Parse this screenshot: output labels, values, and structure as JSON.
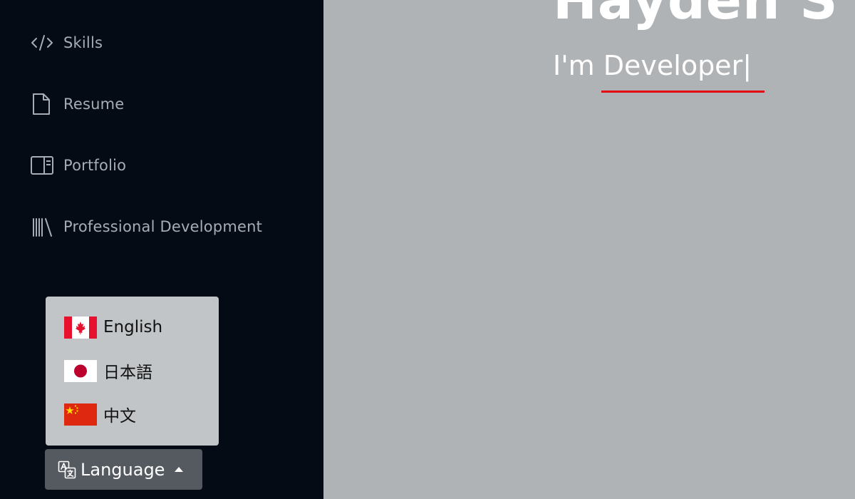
{
  "sidebar": {
    "items": [
      {
        "label": "Skills",
        "icon": "code-icon"
      },
      {
        "label": "Resume",
        "icon": "file-icon"
      },
      {
        "label": "Portfolio",
        "icon": "layout-icon"
      },
      {
        "label": "Professional Development",
        "icon": "library-icon"
      }
    ]
  },
  "hero": {
    "name": "Hayden S",
    "subtitle_prefix": "I'm ",
    "subtitle_word": "Developer",
    "cursor": "|"
  },
  "language_menu": {
    "options": [
      {
        "label": "English",
        "flag": "canada-flag-icon"
      },
      {
        "label": "日本語",
        "flag": "japan-flag-icon"
      },
      {
        "label": "中文",
        "flag": "china-flag-icon"
      }
    ]
  },
  "language_button": {
    "label": "Language",
    "icon": "translate-icon",
    "caret": "caret-up-icon"
  },
  "colors": {
    "sidebar_bg": "#040b14",
    "main_bg": "#b0b3b6",
    "accent_underline": "#e30613",
    "menu_bg": "#c2c5c8",
    "button_bg": "#555a60"
  }
}
